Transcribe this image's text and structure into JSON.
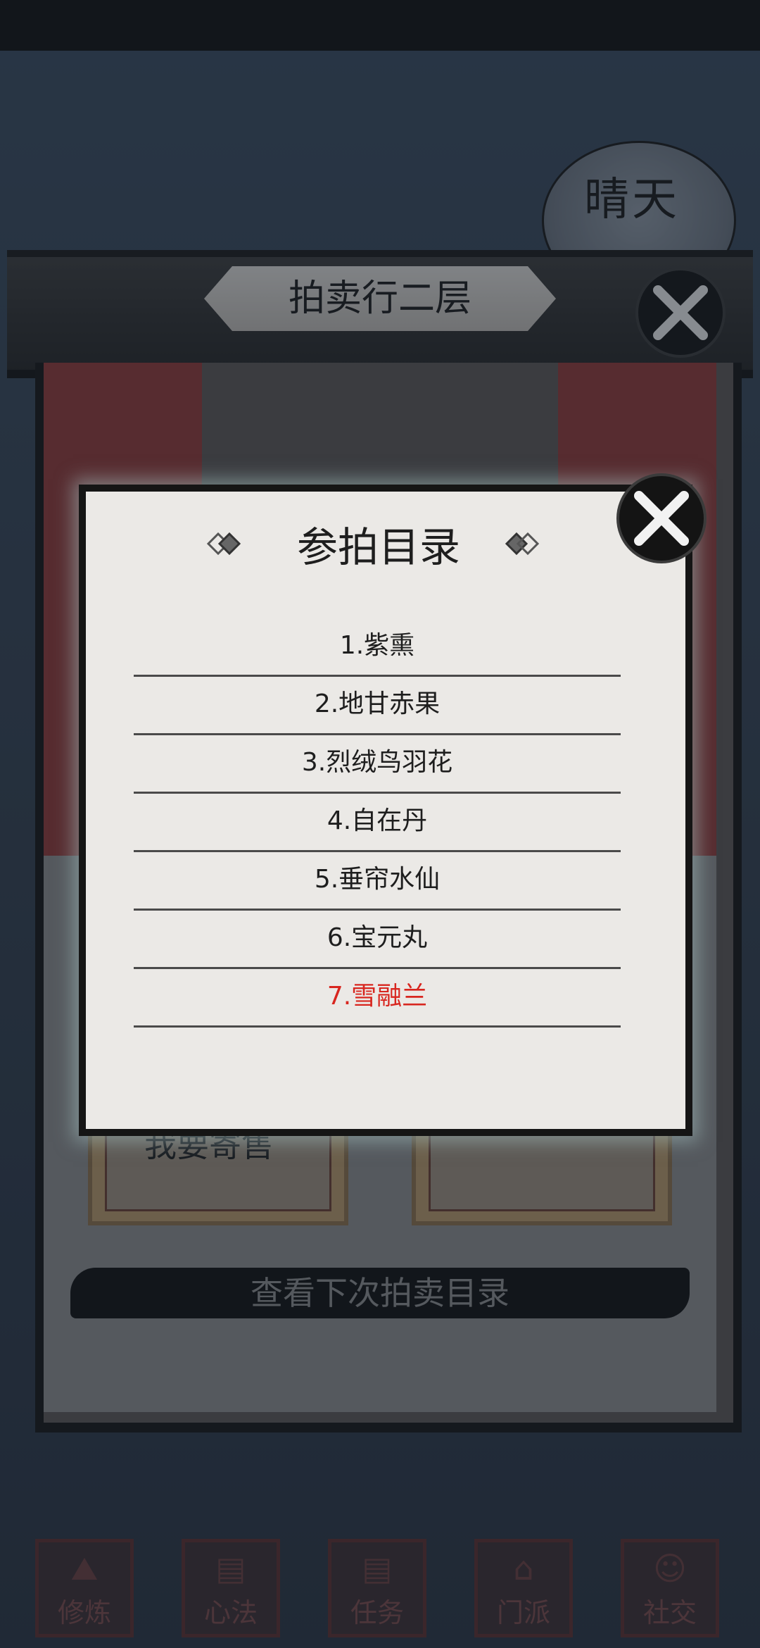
{
  "weather": {
    "label": "晴天"
  },
  "auction_house": {
    "title": "拍卖行二层",
    "buttons": {
      "sell_label": "我要寄售",
      "next_catalog_label": "查看下次拍卖目录"
    }
  },
  "catalog_dialog": {
    "title": "参拍目录",
    "items": [
      {
        "label": "1.紫熏",
        "highlighted": false
      },
      {
        "label": "2.地甘赤果",
        "highlighted": false
      },
      {
        "label": "3.烈绒鸟羽花",
        "highlighted": false
      },
      {
        "label": "4.自在丹",
        "highlighted": false
      },
      {
        "label": "5.垂帘水仙",
        "highlighted": false
      },
      {
        "label": "6.宝元丸",
        "highlighted": false
      },
      {
        "label": "7.雪融兰",
        "highlighted": true
      }
    ],
    "highlight_color": "#d8261f"
  },
  "bottom_nav": [
    {
      "label": "修炼",
      "icon": "mountain-icon"
    },
    {
      "label": "心法",
      "icon": "scroll-icon"
    },
    {
      "label": "任务",
      "icon": "scroll-icon"
    },
    {
      "label": "门派",
      "icon": "pavilion-icon"
    },
    {
      "label": "社交",
      "icon": "people-icon"
    }
  ]
}
